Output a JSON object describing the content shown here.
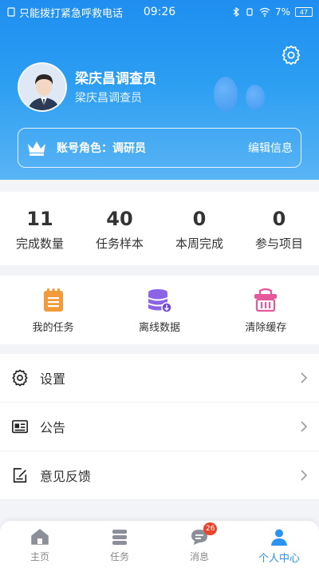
{
  "status_bar": {
    "carrier": "只能拨打紧急呼救电话",
    "time": "09:26",
    "battery": "7%",
    "battery_icon_text": "47"
  },
  "profile": {
    "name": "梁庆昌调查员",
    "subtitle": "梁庆昌调查员",
    "role_label": "账号角色：",
    "role_value": "调研员",
    "edit_label": "编辑信息"
  },
  "stats": [
    {
      "value": "11",
      "label": "完成数量"
    },
    {
      "value": "40",
      "label": "任务样本"
    },
    {
      "value": "0",
      "label": "本周完成"
    },
    {
      "value": "0",
      "label": "参与项目"
    }
  ],
  "tools": [
    {
      "label": "我的任务",
      "icon": "task-list-icon"
    },
    {
      "label": "离线数据",
      "icon": "database-icon"
    },
    {
      "label": "清除缓存",
      "icon": "basket-icon"
    }
  ],
  "menu": [
    {
      "label": "设置",
      "icon": "gear-icon"
    },
    {
      "label": "公告",
      "icon": "newspaper-icon"
    },
    {
      "label": "意见反馈",
      "icon": "feedback-icon"
    }
  ],
  "tabs": [
    {
      "label": "主页",
      "icon": "home-icon"
    },
    {
      "label": "任务",
      "icon": "tasks-icon"
    },
    {
      "label": "消息",
      "icon": "message-icon",
      "badge": "26"
    },
    {
      "label": "个人中心",
      "icon": "person-icon"
    }
  ],
  "colors": {
    "accent": "#2b93f0",
    "badge": "#e8442c",
    "tool_orange": "#f39a3b",
    "tool_purple": "#8a63e6",
    "tool_pink": "#e7579b"
  }
}
